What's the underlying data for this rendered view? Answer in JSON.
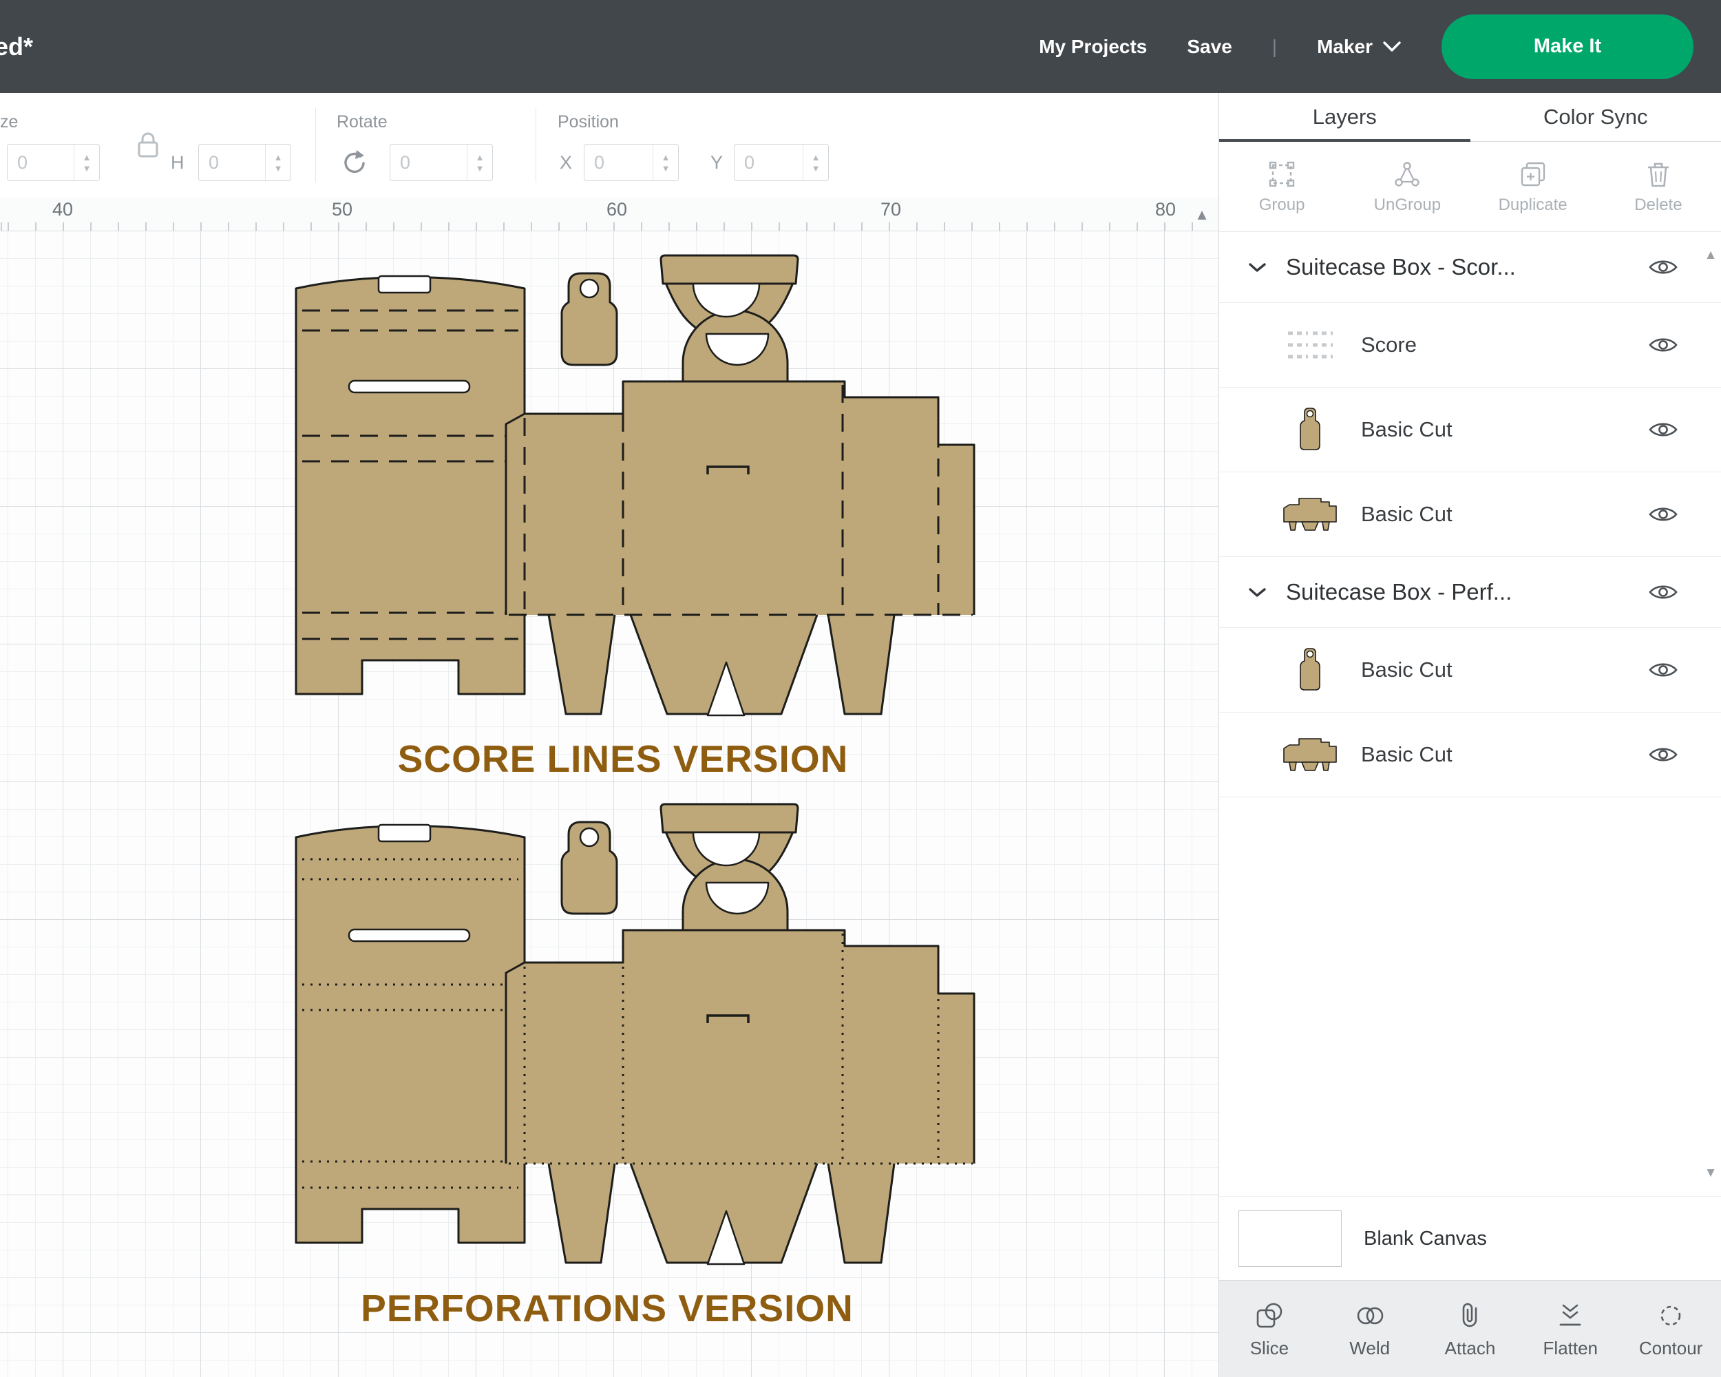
{
  "header": {
    "title": "ed*",
    "my_projects": "My Projects",
    "save": "Save",
    "divider": "|",
    "machine": "Maker",
    "make_it": "Make It"
  },
  "toolbar": {
    "size_label": "ze",
    "w_value": "0",
    "h_label": "H",
    "h_value": "0",
    "rotate_label": "Rotate",
    "rotate_value": "0",
    "position_label": "Position",
    "x_label": "X",
    "x_value": "0",
    "y_label": "Y",
    "y_value": "0"
  },
  "ruler": {
    "ticks": [
      "40",
      "50",
      "60",
      "70",
      "80"
    ]
  },
  "canvas": {
    "score_label": "SCORE LINES VERSION",
    "perforations_label": "PERFORATIONS VERSION"
  },
  "layers_panel": {
    "tabs": [
      "Layers",
      "Color Sync"
    ],
    "actions": [
      "Group",
      "UnGroup",
      "Duplicate",
      "Delete"
    ],
    "rows": [
      {
        "type": "group",
        "label": "Suitecase Box - Scor..."
      },
      {
        "type": "item",
        "label": "Score",
        "thumb": "score"
      },
      {
        "type": "item",
        "label": "Basic Cut",
        "thumb": "tag"
      },
      {
        "type": "item",
        "label": "Basic Cut",
        "thumb": "box"
      },
      {
        "type": "group",
        "label": "Suitecase Box - Perf..."
      },
      {
        "type": "item",
        "label": "Basic Cut",
        "thumb": "tag"
      },
      {
        "type": "item",
        "label": "Basic Cut",
        "thumb": "box"
      }
    ],
    "blank_canvas": "Blank Canvas",
    "bottom_actions": [
      "Slice",
      "Weld",
      "Attach",
      "Flatten",
      "Contour"
    ]
  },
  "glyphs": {
    "spinner_up": "▲",
    "spinner_down": "▼",
    "scroll_up": "▲",
    "scroll_down": "▼"
  },
  "colors": {
    "topbar": "#42474b",
    "accent_green": "#00a76b",
    "tan": "#bea87a",
    "label_brown": "#8f5d10"
  }
}
